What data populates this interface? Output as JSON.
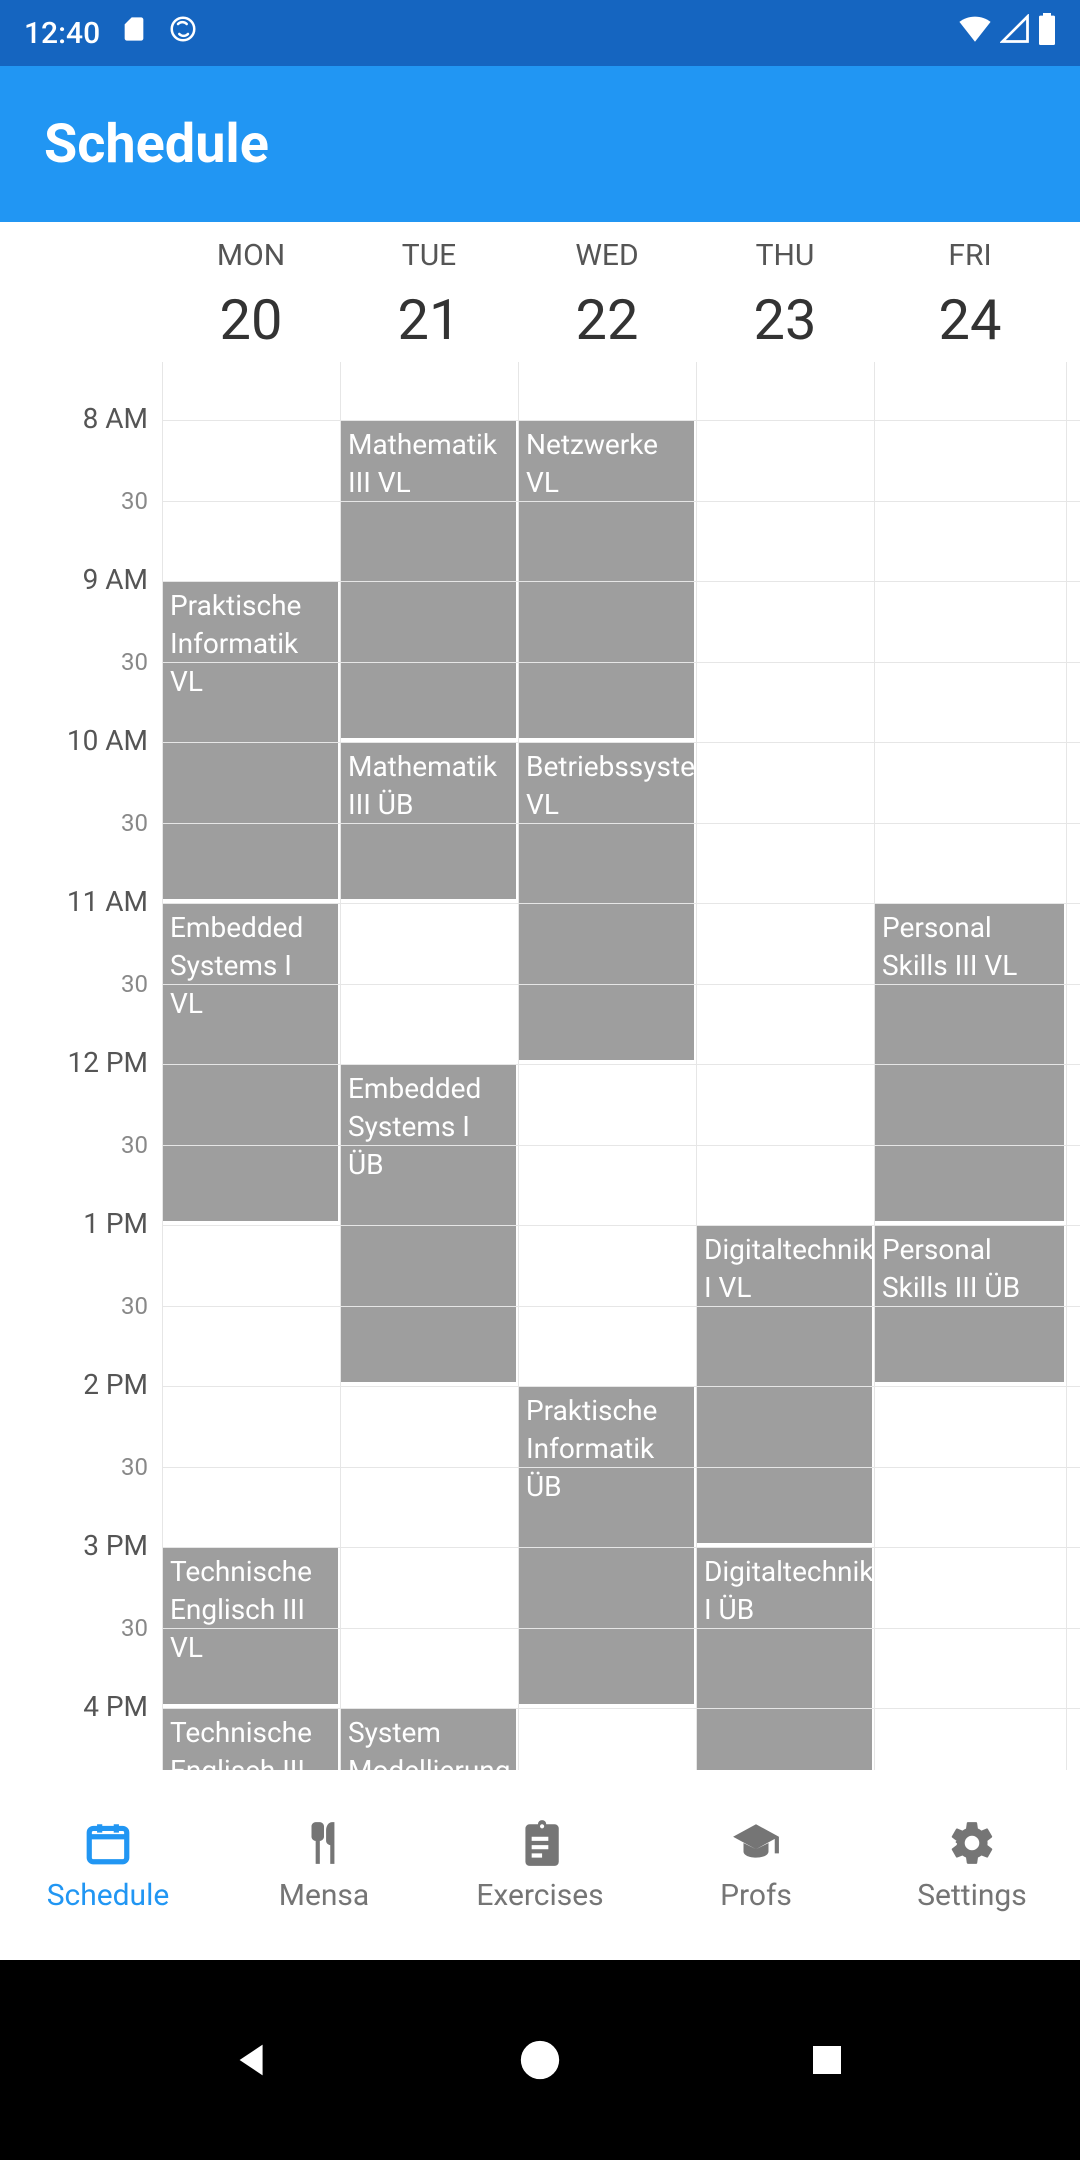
{
  "status": {
    "time": "12:40"
  },
  "app": {
    "title": "Schedule"
  },
  "days": [
    {
      "abbr": "MON",
      "num": "20"
    },
    {
      "abbr": "TUE",
      "num": "21"
    },
    {
      "abbr": "WED",
      "num": "22"
    },
    {
      "abbr": "THU",
      "num": "23"
    },
    {
      "abbr": "FRI",
      "num": "24"
    }
  ],
  "hours": [
    "8 AM",
    "9 AM",
    "10 AM",
    "11 AM",
    "12 PM",
    "1 PM",
    "2 PM",
    "3 PM",
    "4 PM"
  ],
  "half": "30",
  "events": {
    "mon": [
      {
        "t": "Praktische Informatik VL",
        "start": 9,
        "dur": 2
      },
      {
        "t": "Embedded Systems I VL",
        "start": 11,
        "dur": 2
      },
      {
        "t": "Technische Englisch III VL",
        "start": 15,
        "dur": 1
      },
      {
        "t": "Technische Englisch III ÜB",
        "start": 16,
        "dur": 1
      }
    ],
    "tue": [
      {
        "t": "Mathematik III VL",
        "start": 8,
        "dur": 2
      },
      {
        "t": "Mathematik III ÜB",
        "start": 10,
        "dur": 1
      },
      {
        "t": "Embedded Systems I ÜB",
        "start": 12,
        "dur": 2
      },
      {
        "t": "System Modellierung II VL",
        "start": 16,
        "dur": 1
      }
    ],
    "wed": [
      {
        "t": "Netzwerke VL",
        "start": 8,
        "dur": 2
      },
      {
        "t": "Betriebssysteme VL",
        "start": 10,
        "dur": 2
      },
      {
        "t": "Praktische Informatik ÜB",
        "start": 14,
        "dur": 2
      }
    ],
    "thu": [
      {
        "t": "Digitaltechnik I VL",
        "start": 13,
        "dur": 2
      },
      {
        "t": "Digitaltechnik I ÜB",
        "start": 15,
        "dur": 2
      }
    ],
    "fri": [
      {
        "t": "Personal Skills III VL",
        "start": 11,
        "dur": 2
      },
      {
        "t": "Personal Skills III ÜB",
        "start": 13,
        "dur": 1
      }
    ]
  },
  "nav": {
    "schedule": "Schedule",
    "mensa": "Mensa",
    "exercises": "Exercises",
    "profs": "Profs",
    "settings": "Settings"
  }
}
